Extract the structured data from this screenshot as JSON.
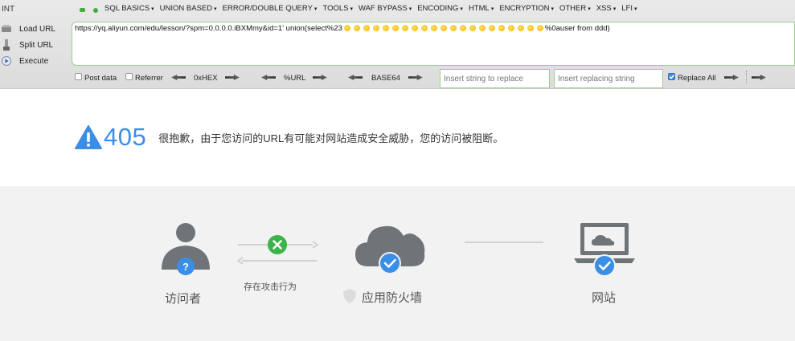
{
  "hackbar": {
    "title": "INT",
    "menu": [
      "SQL BASICS",
      "UNION BASED",
      "ERROR/DOUBLE QUERY",
      "TOOLS",
      "WAF BYPASS",
      "ENCODING",
      "HTML",
      "ENCRYPTION",
      "OTHER",
      "XSS",
      "LFI"
    ],
    "side_buttons": [
      "Load URL",
      "Split URL",
      "Execute"
    ],
    "url_prefix": "https://yq.aliyun.com/edu/lesson/?spm=0.0.0.0.iBXMmy&id=1' union(select%23",
    "url_suffix": "%0auser from ddd)",
    "post_data_label": "Post data",
    "referrer_label": "Referrer",
    "hex_label": "0xHEX",
    "url_label": "%URL",
    "base64_label": "BASE64",
    "replace_placeholder": "Insert string to replace",
    "replacing_placeholder": "Insert replacing string",
    "replace_all_label": "Replace All",
    "post_data_checked": false,
    "referrer_checked": false,
    "replace_all_checked": true
  },
  "error": {
    "code": "405",
    "message": "很抱歉，由于您访问的URL有可能对网站造成安全威胁，您的访问被阻断。"
  },
  "diagram": {
    "visitor_label": "访问者",
    "attack_label": "存在攻击行为",
    "firewall_label": "应用防火墙",
    "website_label": "网站"
  },
  "colors": {
    "accent_blue": "#3a8ee6",
    "green_ok": "#3cb44b",
    "icon_gray": "#6f7479"
  }
}
